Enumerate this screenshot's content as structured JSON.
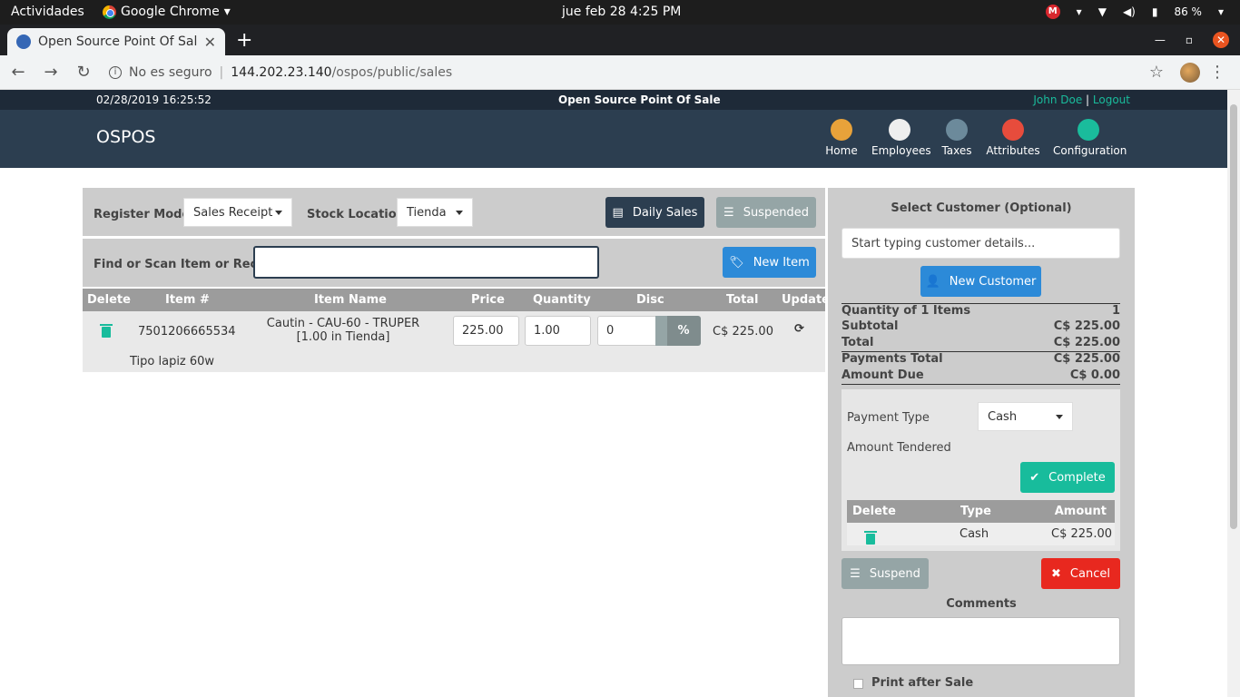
{
  "os": {
    "activities": "Actividades",
    "app_name": "Google Chrome",
    "clock": "jue feb 28   4:25 PM",
    "mega": "M",
    "battery": "86 %"
  },
  "browser": {
    "tab_title": "Open Source Point Of Sale",
    "security": "No es seguro",
    "url_host": "144.202.23.140",
    "url_path": "/ospos/public/sales"
  },
  "app": {
    "datetime": "02/28/2019 16:25:52",
    "app_title": "Open Source Point Of Sale",
    "user": "John Doe",
    "logout": "Logout",
    "brand": "OSPOS",
    "nav": [
      {
        "label": "Home",
        "icon": "home-icon",
        "color": "#e8a23a"
      },
      {
        "label": "Employees",
        "icon": "employees-icon",
        "color": "#eeeeee"
      },
      {
        "label": "Taxes",
        "icon": "taxes-icon",
        "color": "#6c8a9b"
      },
      {
        "label": "Attributes",
        "icon": "attributes-icon",
        "color": "#e74c3c"
      },
      {
        "label": "Configuration",
        "icon": "configuration-icon",
        "color": "#1abc9c"
      }
    ]
  },
  "register": {
    "mode_label": "Register Mode",
    "mode_value": "Sales Receipt",
    "stock_label": "Stock Location",
    "stock_value": "Tienda",
    "daily_sales": "Daily Sales",
    "suspended": "Suspended",
    "find_label": "Find or Scan Item or Receipt",
    "new_item": "New Item"
  },
  "cart": {
    "headers": [
      "Delete",
      "Item #",
      "Item Name",
      "Price",
      "Quantity",
      "Disc",
      "Total",
      "Update"
    ],
    "item": {
      "number": "7501206665534",
      "name_line1": "Cautin - CAU-60 - TRUPER",
      "name_line2": "[1.00 in Tienda]",
      "price": "225.00",
      "quantity": "1.00",
      "discount": "0",
      "disc_type": "%",
      "total": "C$ 225.00",
      "description": "Tipo lapiz 60w"
    }
  },
  "customer": {
    "title": "Select Customer (Optional)",
    "placeholder": "Start typing customer details...",
    "new_customer": "New Customer"
  },
  "totals": {
    "qty_label": "Quantity of 1 Items",
    "qty_value": "1",
    "subtotal_label": "Subtotal",
    "subtotal_value": "C$ 225.00",
    "total_label": "Total",
    "total_value": "C$ 225.00",
    "payments_label": "Payments Total",
    "payments_value": "C$ 225.00",
    "due_label": "Amount Due",
    "due_value": "C$ 0.00"
  },
  "payment": {
    "type_label": "Payment Type",
    "type_value": "Cash",
    "tendered_label": "Amount Tendered",
    "complete": "Complete",
    "headers": [
      "Delete",
      "Type",
      "Amount"
    ],
    "row_type": "Cash",
    "row_amount": "C$ 225.00"
  },
  "actions": {
    "suspend": "Suspend",
    "cancel": "Cancel",
    "comments_label": "Comments",
    "print_after_sale": "Print after Sale"
  }
}
